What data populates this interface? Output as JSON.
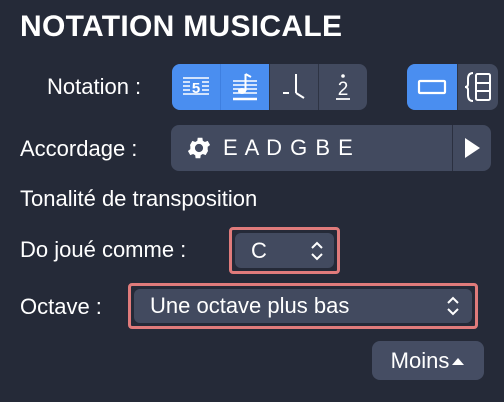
{
  "panel": {
    "title": "NOTATION MUSICALE",
    "notation_label": "Notation :",
    "tuning_label": "Accordage :",
    "tuning_value": "E A D G B E",
    "transposition_heading": "Tonalité de transposition",
    "do_label": "Do joué comme :",
    "do_value": "C",
    "octave_label": "Octave :",
    "octave_value": "Une octave plus bas",
    "less_button": "Moins"
  },
  "notation_buttons": [
    {
      "icon": "tablature-number-icon",
      "glyph": "5",
      "active": true
    },
    {
      "icon": "tab-note-icon",
      "active": true
    },
    {
      "icon": "stem-notation-icon",
      "active": false
    },
    {
      "icon": "numbered-notation-icon",
      "glyph": "2",
      "active": false
    }
  ],
  "view_buttons": [
    {
      "icon": "single-staff-icon",
      "active": true
    },
    {
      "icon": "brace-staff-icon",
      "active": false
    }
  ],
  "colors": {
    "background": "#252a38",
    "control": "#424a5f",
    "accent": "#4a8ef0",
    "highlight": "#e07b7b"
  }
}
